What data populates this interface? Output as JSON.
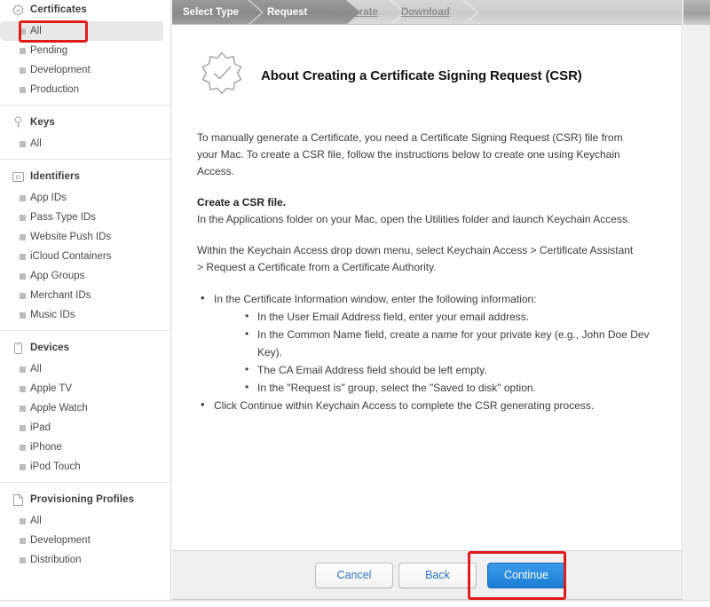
{
  "sidebar": {
    "groups": [
      {
        "icon": "certificate-badge-icon",
        "label": "Certificates",
        "items": [
          {
            "label": "All",
            "selected": true
          },
          {
            "label": "Pending",
            "selected": false
          },
          {
            "label": "Development",
            "selected": false
          },
          {
            "label": "Production",
            "selected": false
          }
        ]
      },
      {
        "icon": "key-icon",
        "label": "Keys",
        "items": [
          {
            "label": "All",
            "selected": false
          }
        ]
      },
      {
        "icon": "identifier-id-icon",
        "label": "Identifiers",
        "items": [
          {
            "label": "App IDs",
            "selected": false
          },
          {
            "label": "Pass Type IDs",
            "selected": false
          },
          {
            "label": "Website Push IDs",
            "selected": false
          },
          {
            "label": "iCloud Containers",
            "selected": false
          },
          {
            "label": "App Groups",
            "selected": false
          },
          {
            "label": "Merchant IDs",
            "selected": false
          },
          {
            "label": "Music IDs",
            "selected": false
          }
        ]
      },
      {
        "icon": "device-phone-icon",
        "label": "Devices",
        "items": [
          {
            "label": "All",
            "selected": false
          },
          {
            "label": "Apple TV",
            "selected": false
          },
          {
            "label": "Apple Watch",
            "selected": false
          },
          {
            "label": "iPad",
            "selected": false
          },
          {
            "label": "iPhone",
            "selected": false
          },
          {
            "label": "iPod Touch",
            "selected": false
          }
        ]
      },
      {
        "icon": "document-page-icon",
        "label": "Provisioning Profiles",
        "items": [
          {
            "label": "All",
            "selected": false
          },
          {
            "label": "Development",
            "selected": false
          },
          {
            "label": "Distribution",
            "selected": false
          }
        ]
      }
    ]
  },
  "stepper": {
    "steps": [
      {
        "label": "Select Type",
        "state": "completed"
      },
      {
        "label": "Request",
        "state": "current"
      },
      {
        "label": "Generate",
        "state": "upcoming"
      },
      {
        "label": "Download",
        "state": "upcoming"
      }
    ]
  },
  "main": {
    "icon": "certificate-badge-check-icon",
    "title": "About Creating a Certificate Signing Request (CSR)",
    "intro": "To manually generate a Certificate, you need a Certificate Signing Request (CSR) file from your Mac. To create a CSR file, follow the instructions below to create one using Keychain Access.",
    "subhead": "Create a CSR file.",
    "step_applications": "In the Applications folder on your Mac, open the Utilities folder and launch Keychain Access.",
    "step_menu": "Within the Keychain Access drop down menu, select Keychain Access > Certificate Assistant > Request a Certificate from a Certificate Authority.",
    "bullets": [
      {
        "text": "In the Certificate Information window, enter the following information:",
        "children": [
          "In the User Email Address field, enter your email address.",
          "In the Common Name field, create a name for your private key (e.g., John Doe Dev Key).",
          "The CA Email Address field should be left empty.",
          "In the \"Request is\" group, select the \"Saved to disk\" option."
        ]
      },
      {
        "text": "Click Continue within Keychain Access to complete the CSR generating process.",
        "children": []
      }
    ]
  },
  "footer": {
    "cancel_label": "Cancel",
    "back_label": "Back",
    "continue_label": "Continue"
  },
  "annotations": {
    "highlight_color": "#e01b1b",
    "targets": [
      "sidebar-item-all",
      "continue-button"
    ]
  },
  "colors": {
    "primary_button": "#1a7ed6",
    "link_text": "#2b73c4",
    "stepper_dark": "#8a8a8a",
    "stepper_light": "#d2d2d2"
  }
}
